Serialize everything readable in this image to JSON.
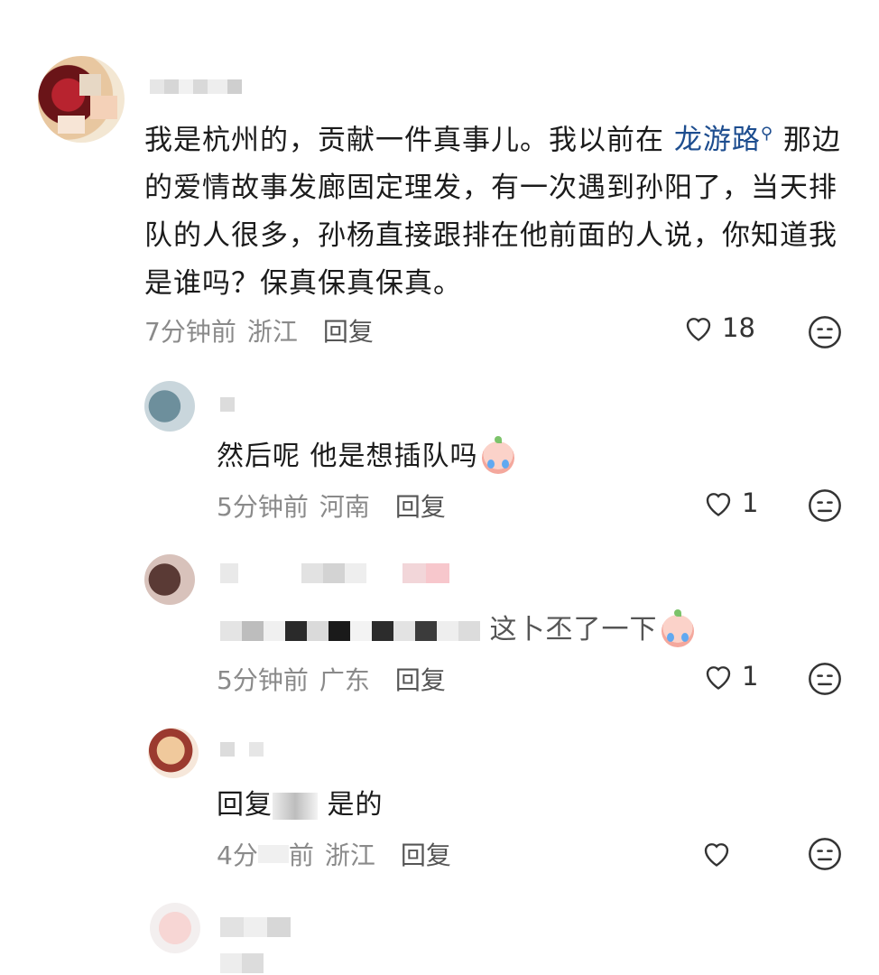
{
  "comments": [
    {
      "text_before_link": "我是杭州的，贡献一件真事儿。我以前在",
      "link": "龙游路",
      "text_after_link": "那边的爱情故事发廊固定理发，有一次遇到孙阳了，当天排队的人很多，孙杨直接跟排在他前面的人说，你知道我是谁吗？保真保真保真。",
      "time": "7分钟前",
      "location": "浙江",
      "reply_label": "回复",
      "likes": "18"
    },
    {
      "text": "然后呢 他是想插队吗",
      "time": "5分钟前",
      "location": "河南",
      "reply_label": "回复",
      "likes": "1"
    },
    {
      "text_fragment": "这卜丕了一下",
      "time": "5分钟前",
      "location": "广东",
      "reply_label": "回复",
      "likes": "1"
    },
    {
      "text_start": "回复",
      "text_end": "是的",
      "time_start": "4分",
      "time_end": "前",
      "location": "浙江",
      "reply_label": "回复",
      "likes": ""
    }
  ],
  "icons": {
    "like": "heart-outline-icon",
    "dislike": "neutral-face-icon",
    "search": "search-icon"
  },
  "colors": {
    "link": "#1d4d8f",
    "meta": "#8a8a8a",
    "text": "#1b1b1b"
  }
}
